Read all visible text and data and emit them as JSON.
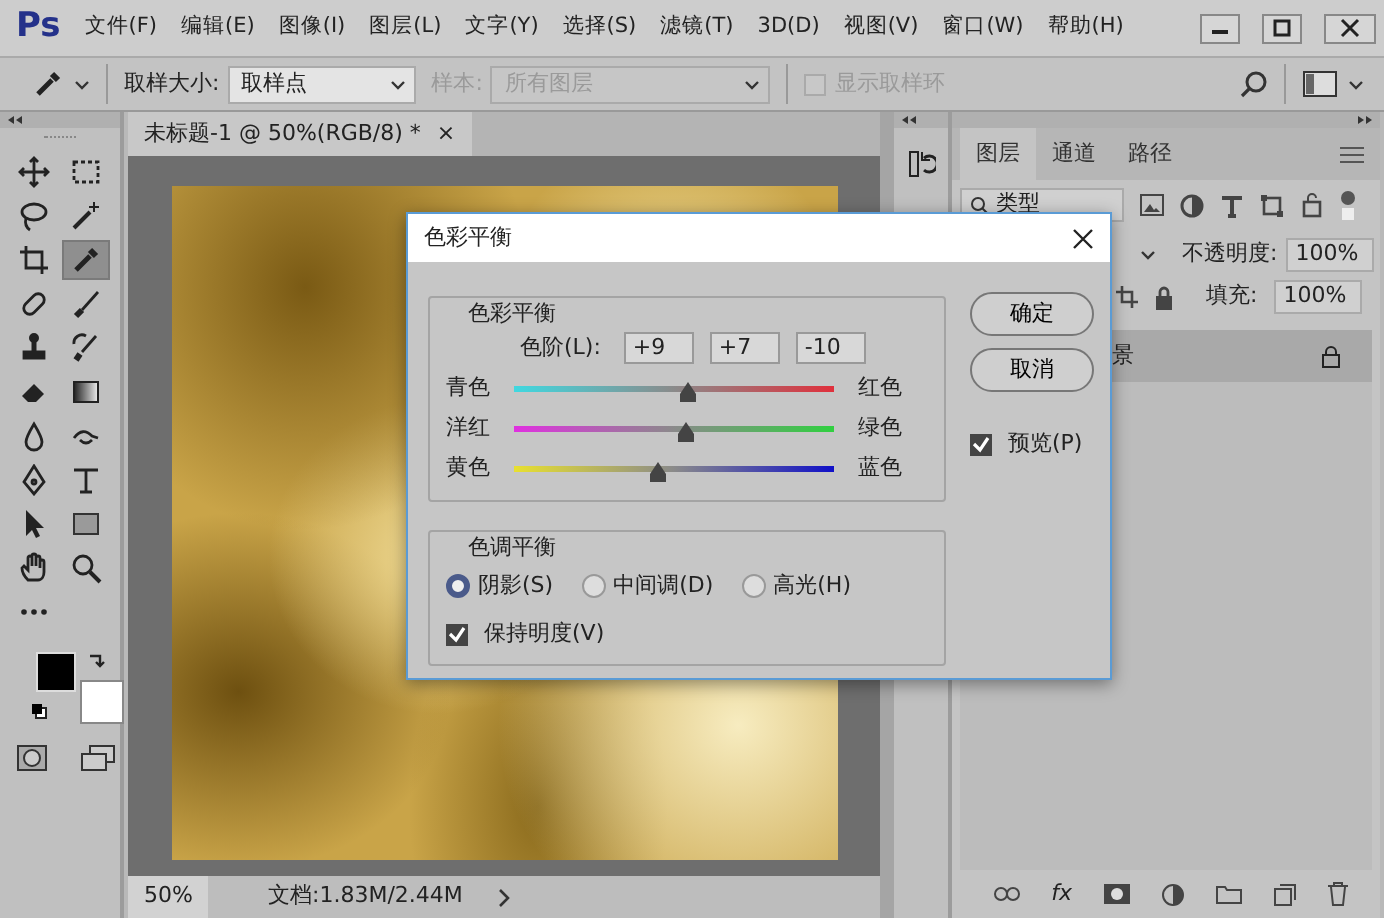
{
  "app": {
    "logo": "Ps"
  },
  "menu": [
    "文件(F)",
    "编辑(E)",
    "图像(I)",
    "图层(L)",
    "文字(Y)",
    "选择(S)",
    "滤镜(T)",
    "3D(D)",
    "视图(V)",
    "窗口(W)",
    "帮助(H)"
  ],
  "options_bar": {
    "sample_size_label": "取样大小:",
    "sample_size_value": "取样点",
    "sample_label": "样本:",
    "sample_value": "所有图层",
    "sample_disabled": true,
    "show_ring": {
      "label": "显示取样环",
      "checked": false,
      "disabled": true
    }
  },
  "tools": [
    {
      "kind": "move",
      "selected": false
    },
    {
      "kind": "marquee",
      "selected": false
    },
    {
      "kind": "lasso",
      "selected": false
    },
    {
      "kind": "wand",
      "selected": false
    },
    {
      "kind": "crop",
      "selected": false
    },
    {
      "kind": "eyedropper",
      "selected": true
    },
    {
      "kind": "bandage",
      "selected": false
    },
    {
      "kind": "brush",
      "selected": false
    },
    {
      "kind": "stamp",
      "selected": false
    },
    {
      "kind": "history_brush",
      "selected": false
    },
    {
      "kind": "eraser",
      "selected": false
    },
    {
      "kind": "gradient",
      "selected": false
    },
    {
      "kind": "blur",
      "selected": false
    },
    {
      "kind": "smudge",
      "selected": false
    },
    {
      "kind": "pen",
      "selected": false
    },
    {
      "kind": "type",
      "selected": false
    },
    {
      "kind": "path_select",
      "selected": false
    },
    {
      "kind": "rectangle",
      "selected": false
    },
    {
      "kind": "hand",
      "selected": false
    },
    {
      "kind": "zoom",
      "selected": false
    },
    {
      "kind": "more",
      "selected": false
    }
  ],
  "document": {
    "tab_title": "未标题-1 @ 50%(RGB/8) *",
    "tab_close": "×",
    "zoom": "50%",
    "doc_info": "文档:1.83M/2.44M"
  },
  "layers_panel": {
    "tabs": [
      {
        "label": "图层",
        "selected": true
      },
      {
        "label": "通道",
        "selected": false
      },
      {
        "label": "路径",
        "selected": false
      }
    ],
    "filter_label": "类型",
    "opacity_label": "不透明度:",
    "opacity_value": "100%",
    "fill_label": "填充:",
    "fill_value": "100%",
    "layers": [
      {
        "name": "景",
        "locked": true,
        "selected": true
      }
    ],
    "footer_fx": "fx"
  },
  "dialog": {
    "title": "色彩平衡",
    "color_group": "色彩平衡",
    "levels_label": "色阶(L):",
    "levels": [
      "+9",
      "+7",
      "-10"
    ],
    "sliders": [
      {
        "left": "青色",
        "right": "红色",
        "level": 0.545
      },
      {
        "left": "洋红",
        "right": "绿色",
        "level": 0.535
      },
      {
        "left": "黄色",
        "right": "蓝色",
        "level": 0.45
      }
    ],
    "tone_group": "色调平衡",
    "tones": [
      {
        "label": "阴影(S)",
        "selected": true
      },
      {
        "label": "中间调(D)",
        "selected": false
      },
      {
        "label": "高光(H)",
        "selected": false
      }
    ],
    "preserve": {
      "label": "保持明度(V)",
      "checked": true
    },
    "buttons": [
      "确定",
      "取消"
    ],
    "preview": {
      "label": "预览(P)",
      "checked": true
    }
  }
}
